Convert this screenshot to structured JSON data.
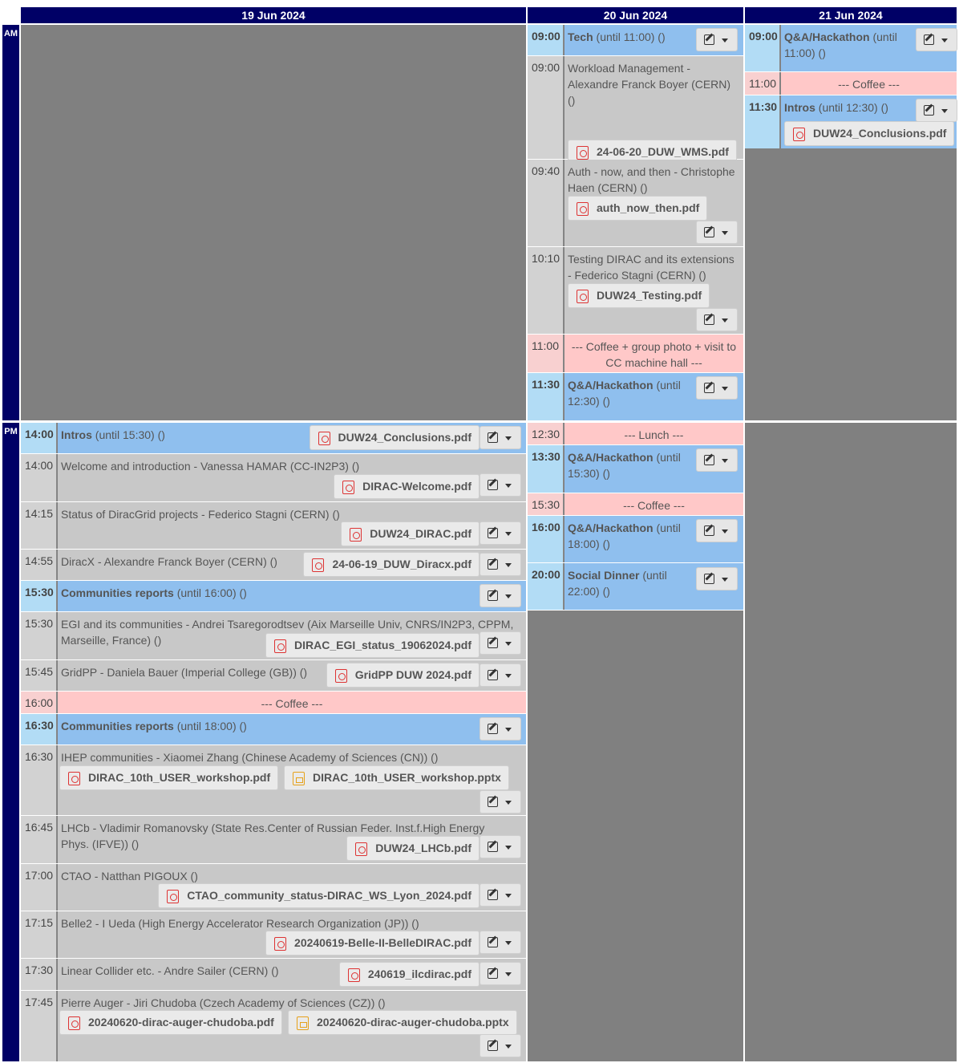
{
  "days": [
    "19 Jun 2024",
    "20 Jun 2024",
    "21 Jun 2024"
  ],
  "ampm": [
    "AM",
    "PM"
  ],
  "d20": [
    {
      "time": "09:00",
      "title": "Tech",
      "rest": " (until 11:00) ()"
    },
    {
      "time": "09:00",
      "text": "Workload Management - Alexandre Franck Boyer (CERN)   ()",
      "att": "24-06-20_DUW_WMS.pdf"
    },
    {
      "time": "09:40",
      "text": "Auth - now, and then - Christophe Haen (CERN)   ()",
      "att": "auth_now_then.pdf"
    },
    {
      "time": "10:10",
      "text": "Testing DIRAC and its extensions - Federico Stagni (CERN)   ()",
      "att": "DUW24_Testing.pdf"
    },
    {
      "time": "11:00",
      "text": "--- Coffee + group photo + visit to CC machine hall ---"
    },
    {
      "time": "11:30",
      "title": "Q&A/Hackathon",
      "rest": " (until 12:30) ()"
    },
    {
      "time": "12:30",
      "text": "--- Lunch ---"
    },
    {
      "time": "13:30",
      "title": "Q&A/Hackathon",
      "rest": " (until 15:30) ()"
    },
    {
      "time": "15:30",
      "text": "--- Coffee ---"
    },
    {
      "time": "16:00",
      "title": "Q&A/Hackathon",
      "rest": " (until 18:00) ()"
    },
    {
      "time": "20:00",
      "title": "Social Dinner",
      "rest": " (until 22:00) ()"
    }
  ],
  "d21": [
    {
      "time": "09:00",
      "title": "Q&A/Hackathon",
      "rest": " (until 11:00) ()"
    },
    {
      "time": "11:00",
      "text": "--- Coffee ---"
    },
    {
      "time": "11:30",
      "title": "Intros",
      "rest": " (until 12:30) ()",
      "att": "DUW24_Conclusions.pdf"
    }
  ],
  "d19": [
    {
      "time": "14:00",
      "title": "Intros",
      "rest": " (until 15:30) ()",
      "att": "DUW24_Conclusions.pdf"
    },
    {
      "time": "14:00",
      "text": "Welcome and introduction - Vanessa HAMAR (CC-IN2P3)   ()",
      "att": "DIRAC-Welcome.pdf"
    },
    {
      "time": "14:15",
      "text": "Status of DiracGrid projects - Federico Stagni (CERN)   ()",
      "att": "DUW24_DIRAC.pdf"
    },
    {
      "time": "14:55",
      "text": "DiracX - Alexandre Franck Boyer (CERN)   ()",
      "att": "24-06-19_DUW_Diracx.pdf"
    },
    {
      "time": "15:30",
      "title": "Communities reports",
      "rest": " (until 16:00) ()"
    },
    {
      "time": "15:30",
      "text": "EGI and its communities - Andrei Tsaregorodtsev (Aix Marseille Univ, CNRS/IN2P3, CPPM, Marseille, France)   ()",
      "att": "DIRAC_EGI_status_19062024.pdf"
    },
    {
      "time": "15:45",
      "text": "GridPP - Daniela Bauer (Imperial College (GB))   ()",
      "att": "GridPP DUW 2024.pdf"
    },
    {
      "time": "16:00",
      "text": "--- Coffee ---"
    },
    {
      "time": "16:30",
      "title": "Communities reports",
      "rest": " (until 18:00) ()"
    },
    {
      "time": "16:30",
      "text": "IHEP communities - Xiaomei Zhang (Chinese Academy of Sciences (CN))   ()",
      "att": "DIRAC_10th_USER_workshop.pdf",
      "att2": "DIRAC_10th_USER_workshop.pptx"
    },
    {
      "time": "16:45",
      "text": "LHCb - Vladimir Romanovsky (State Res.Center of Russian Feder. Inst.f.High Energy Phys. (IFVE))   ()",
      "att": "DUW24_LHCb.pdf"
    },
    {
      "time": "17:00",
      "text": "CTAO - Natthan PIGOUX   ()",
      "att": "CTAO_community_status-DIRAC_WS_Lyon_2024.pdf"
    },
    {
      "time": "17:15",
      "text": "Belle2 - I Ueda (High Energy Accelerator Research Organization (JP))   ()",
      "att": "20240619-Belle-II-BelleDIRAC.pdf"
    },
    {
      "time": "17:30",
      "text": "Linear Collider etc. - Andre Sailer (CERN)   ()",
      "att": "240619_ilcdirac.pdf"
    },
    {
      "time": "17:45",
      "text": "Pierre Auger - Jiri Chudoba (Czech Academy of Sciences (CZ))   ()",
      "att": "20240620-dirac-auger-chudoba.pdf",
      "att2": "20240620-dirac-auger-chudoba.pptx"
    }
  ]
}
